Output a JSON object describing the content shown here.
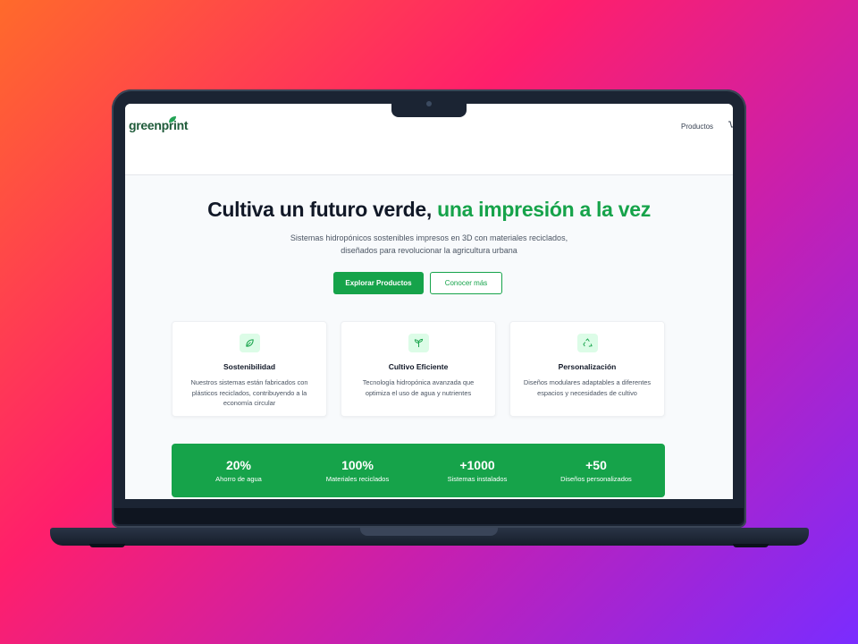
{
  "header": {
    "logo_text": "greenprint",
    "nav": [
      "Productos"
    ]
  },
  "hero": {
    "title_main": "Cultiva un futuro verde, ",
    "title_accent": "una impresión a la vez",
    "subtitle_line1": "Sistemas hidropónicos sostenibles impresos en 3D con materiales reciclados,",
    "subtitle_line2": "diseñados para revolucionar la agricultura urbana",
    "primary_button": "Explorar Productos",
    "secondary_button": "Conocer más"
  },
  "features": [
    {
      "icon": "leaf-icon",
      "title": "Sostenibilidad",
      "description": "Nuestros sistemas están fabricados con plásticos reciclados, contribuyendo a la economía circular"
    },
    {
      "icon": "sprout-icon",
      "title": "Cultivo Eficiente",
      "description": "Tecnología hidropónica avanzada que optimiza el uso de agua y nutrientes"
    },
    {
      "icon": "recycle-icon",
      "title": "Personalización",
      "description": "Diseños modulares adaptables a diferentes espacios y necesidades de cultivo"
    }
  ],
  "stats": [
    {
      "value": "20%",
      "label": "Ahorro de agua"
    },
    {
      "value": "100%",
      "label": "Materiales reciclados"
    },
    {
      "value": "+1000",
      "label": "Sistemas instalados"
    },
    {
      "value": "+50",
      "label": "Diseños personalizados"
    }
  ],
  "colors": {
    "brand_green": "#16a34a",
    "logo_green": "#1f5b3a",
    "icon_bg": "#dcfce7"
  }
}
